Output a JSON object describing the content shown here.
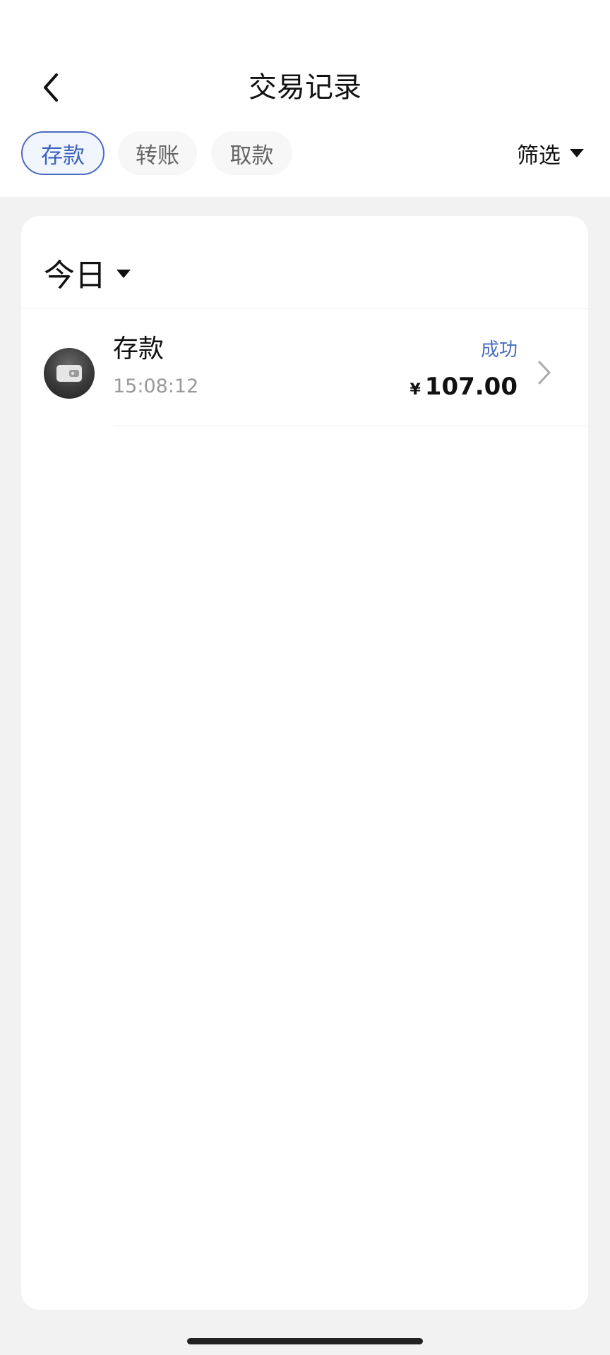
{
  "header": {
    "title": "交易记录",
    "back_icon": "chevron-left-icon"
  },
  "tabs": [
    {
      "label": "存款",
      "active": true
    },
    {
      "label": "转账",
      "active": false
    },
    {
      "label": "取款",
      "active": false
    }
  ],
  "filter": {
    "label": "筛选",
    "icon": "caret-down-icon"
  },
  "colors": {
    "accent": "#4a6cc2",
    "background": "#f2f2f2",
    "card": "#ffffff",
    "muted_text": "#999999"
  },
  "groups": [
    {
      "label": "今日",
      "icon": "caret-down-icon",
      "transactions": [
        {
          "title": "存款",
          "time": "15:08:12",
          "status": "成功",
          "currency": "¥",
          "amount": "107.00",
          "icon": "wallet-icon",
          "chevron": "chevron-right-icon"
        }
      ]
    }
  ]
}
